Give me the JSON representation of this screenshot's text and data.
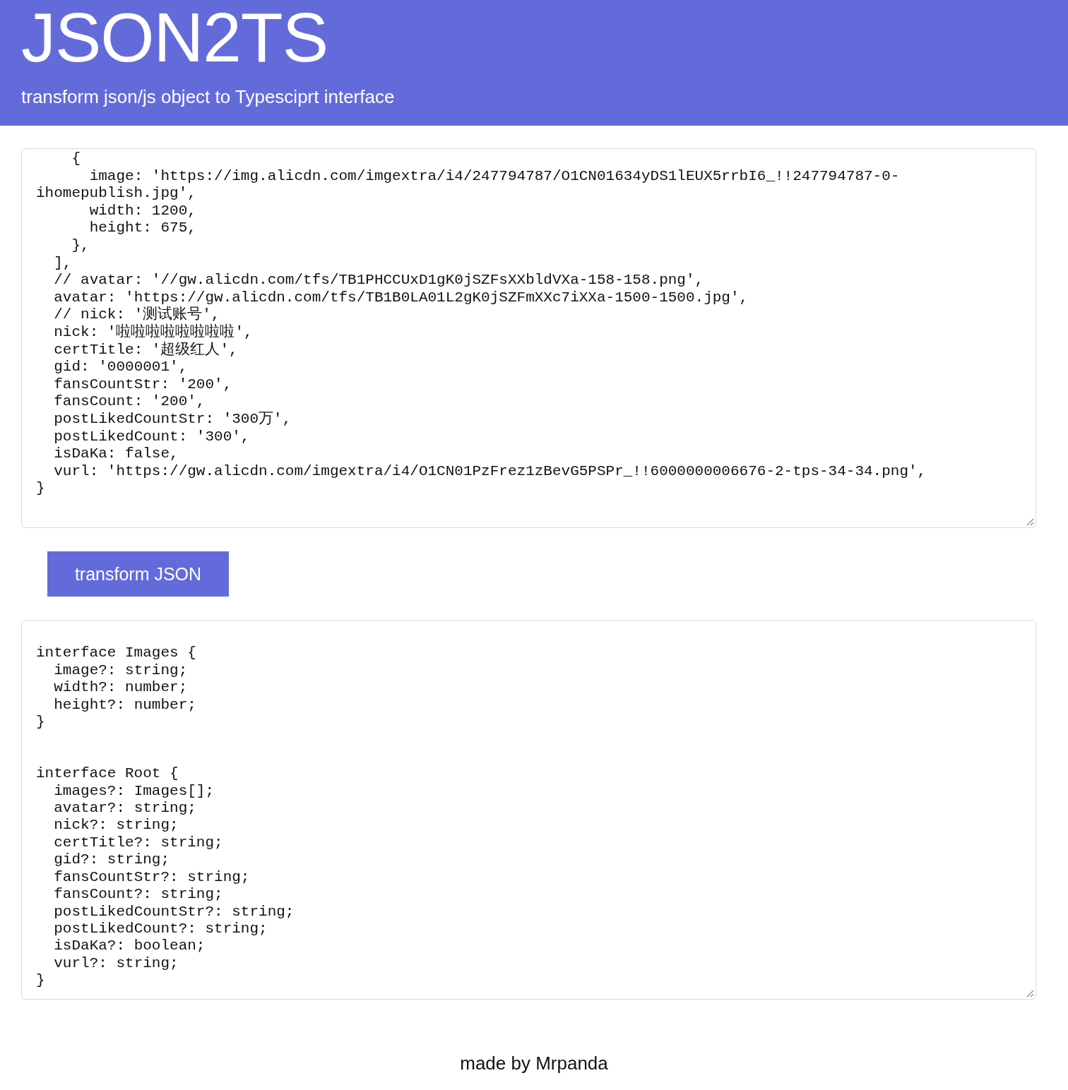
{
  "header": {
    "title": "JSON2TS",
    "subtitle": "transform json/js object to Typesciprt interface"
  },
  "input": {
    "value": "    {\n      image: 'https://img.alicdn.com/imgextra/i4/247794787/O1CN01634yDS1lEUX5rrbI6_!!247794787-0-ihomepublish.jpg',\n      width: 1200,\n      height: 675,\n    },\n  ],\n  // avatar: '//gw.alicdn.com/tfs/TB1PHCCUxD1gK0jSZFsXXbldVXa-158-158.png',\n  avatar: 'https://gw.alicdn.com/tfs/TB1B0LA01L2gK0jSZFmXXc7iXXa-1500-1500.jpg',\n  // nick: '测试账号',\n  nick: '啦啦啦啦啦啦啦啦',\n  certTitle: '超级红人',\n  gid: '0000001',\n  fansCountStr: '200',\n  fansCount: '200',\n  postLikedCountStr: '300万',\n  postLikedCount: '300',\n  isDaKa: false,\n  vurl: 'https://gw.alicdn.com/imgextra/i4/O1CN01PzFrez1zBevG5PSPr_!!6000000006676-2-tps-34-34.png',\n}"
  },
  "transform_button": {
    "label": "transform JSON"
  },
  "output": {
    "value": "\ninterface Images {\n  image?: string;\n  width?: number;\n  height?: number;\n}\n\n\ninterface Root {\n  images?: Images[];\n  avatar?: string;\n  nick?: string;\n  certTitle?: string;\n  gid?: string;\n  fansCountStr?: string;\n  fansCount?: string;\n  postLikedCountStr?: string;\n  postLikedCount?: string;\n  isDaKa?: boolean;\n  vurl?: string;\n}"
  },
  "footer": {
    "text": "made by Mrpanda"
  }
}
